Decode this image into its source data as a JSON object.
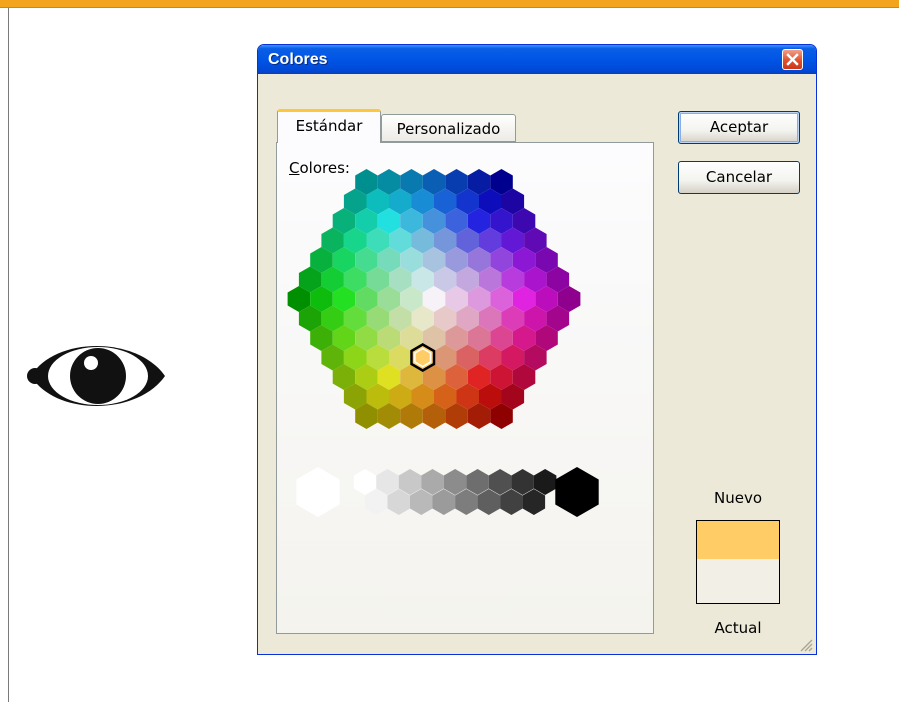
{
  "dialog": {
    "title": "Colores",
    "buttons": {
      "ok": "Aceptar",
      "cancel": "Cancelar"
    },
    "tabs": [
      {
        "label": "Estándar",
        "selected": true
      },
      {
        "label": "Personalizado",
        "selected": false
      }
    ],
    "colors_label": "Colores:",
    "preview": {
      "new_label": "Nuevo",
      "current_label": "Actual",
      "new_color": "#FFCC66",
      "current_color": "#F1EFE6"
    },
    "selected_color": "#FFCC66"
  },
  "page": {
    "accent_bar_color": "#F2A51C",
    "side_icon": "eye-icon"
  }
}
